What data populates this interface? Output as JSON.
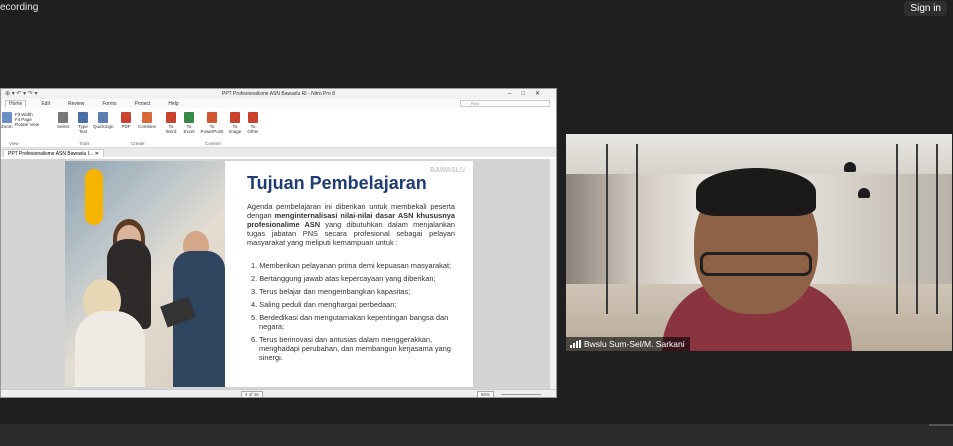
{
  "meeting": {
    "recording_label": "ecording",
    "signin_label": "Sign in"
  },
  "pdf": {
    "title": "PPT Profesionalisme ASN Bawaslu RI - Nitro Pro 8",
    "menu": [
      "Home",
      "Edit",
      "Review",
      "Forms",
      "Protect",
      "Help"
    ],
    "find_placeholder": "Find",
    "ribbon": {
      "view_items": [
        "Fit Width",
        "Fit Page",
        "Rotate View"
      ],
      "zoom_label": "Zoom",
      "tools": [
        "Select",
        "Type Text",
        "QuickSign"
      ],
      "create": [
        "PDF",
        "Combine"
      ],
      "convert": [
        "To Word",
        "To Excel",
        "To PowerPoint",
        "To Image",
        "To Other"
      ],
      "groups": [
        "View",
        "Tools",
        "Create",
        "Convert"
      ]
    },
    "doc_tab": "PPT Profesionalisme ASN Bawaslu I...",
    "slide": {
      "logo": "BAWASLU",
      "title": "Tujuan Pembelajaran",
      "intro_pre": "Agenda pembelajaran ini diberikan untuk membekali peserta dengan ",
      "intro_bold": "menginternalisasi nilai-nilai dasar ASN khususnya profesionalime ASN",
      "intro_post": " yang dibutuhkan dalam menjalankan tugas jabatan PNS secara profesional sebagai pelayan masyarakat yang meliputi kemampuan untuk :",
      "items": [
        "1. Memberikan pelayanan prima demi kepuasan masyarakat;",
        "2. Bertanggung jawab atas kepercayaan yang diberikan;",
        "3. Terus belajar dan mengembangkan kapasitas;",
        "4. Saling peduli dan menghargai perbedaan;",
        "5. Berdedikasi dan mengutamakan kepentingan bangsa dan negara;",
        "6. Terus berinovasi dan antusias dalam menggerakkan, menghadapi perubahan, dan membangun kerjasama yang sinergi."
      ]
    },
    "status": {
      "page": "4 of 20",
      "zoom": "60%"
    }
  },
  "video": {
    "participant": "Bwslu Sum-Sel/M. Sarkani"
  }
}
